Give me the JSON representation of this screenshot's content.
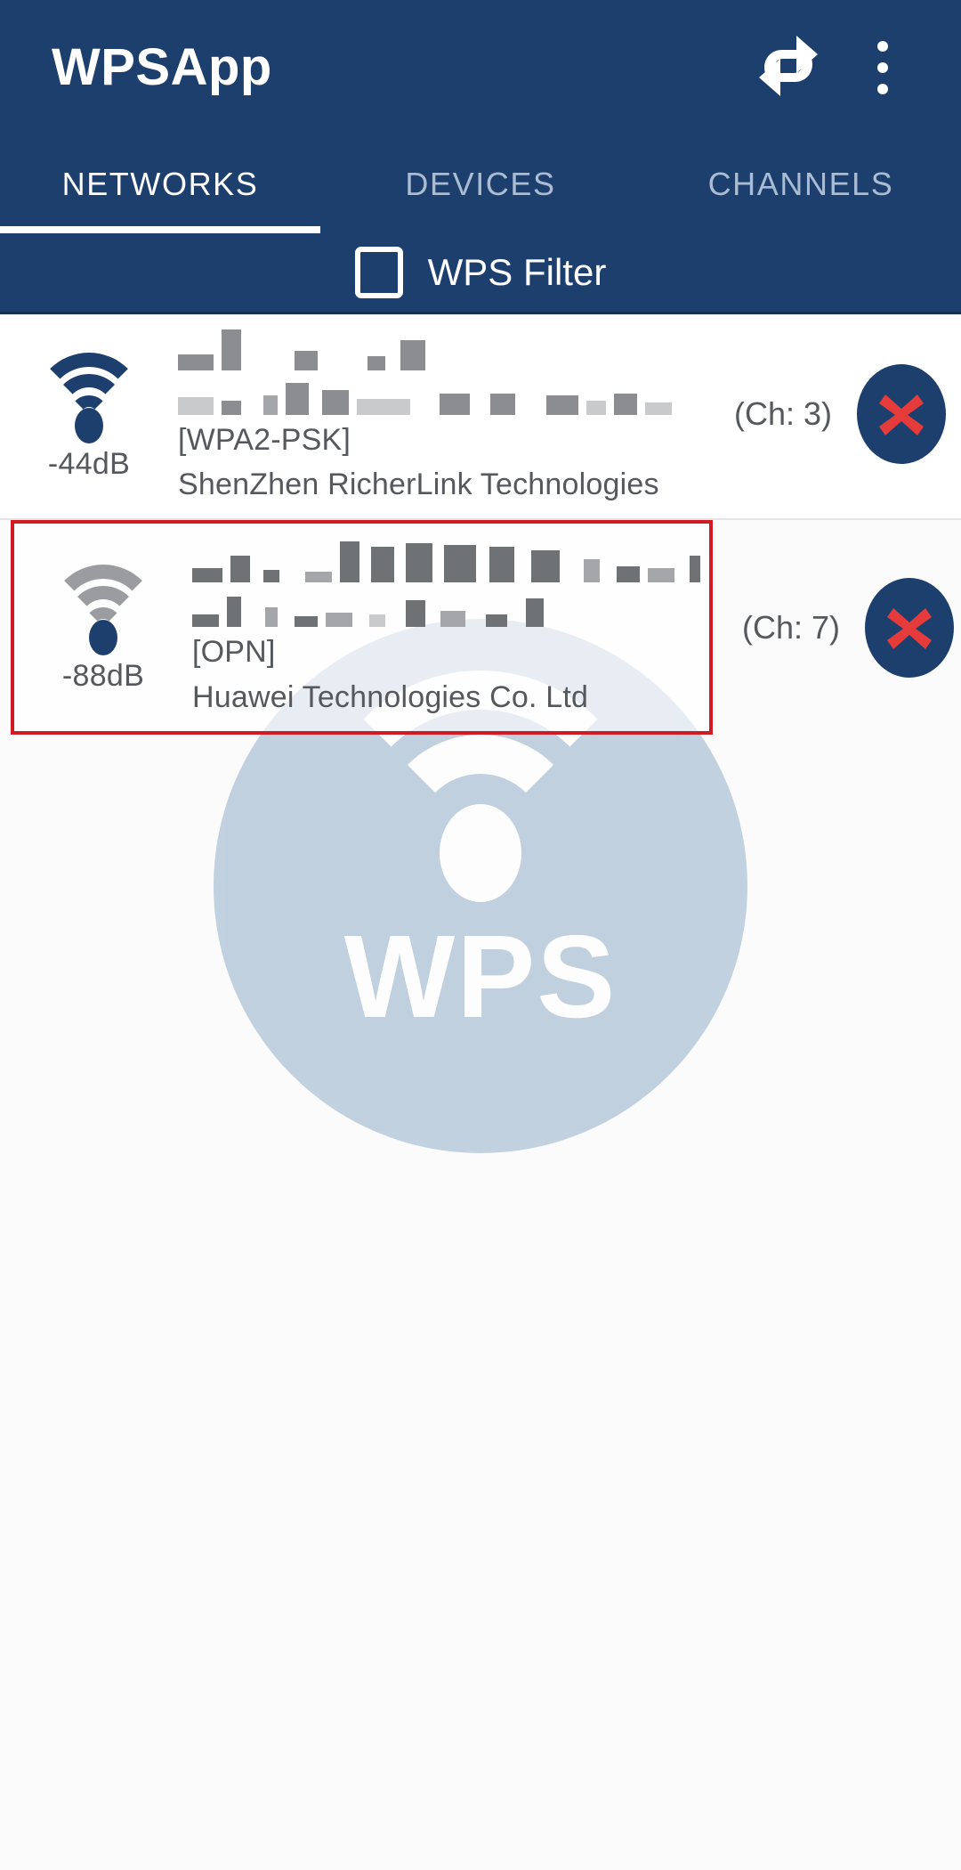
{
  "app": {
    "title": "WPSApp",
    "refresh_icon": "refresh-icon",
    "overflow_icon": "overflow-menu-icon",
    "accent_color": "#1d3f6e",
    "highlight_color": "#d01a24"
  },
  "tabs": [
    {
      "label": "NETWORKS",
      "active": true
    },
    {
      "label": "DEVICES",
      "active": false
    },
    {
      "label": "CHANNELS",
      "active": false
    }
  ],
  "filter": {
    "label": "WPS Filter",
    "checked": false
  },
  "watermark": {
    "text": "WPS",
    "icon": "wifi-icon",
    "color": "#9db6ce"
  },
  "networks": [
    {
      "ssid": "",
      "ssid_redacted": true,
      "signal": "-44dB",
      "signal_strength": 4,
      "signal_color": "#1d3f6e",
      "security": "[WPA2-PSK]",
      "vendor": "ShenZhen RicherLink Technologies",
      "channel": "(Ch: 3)",
      "status_icon": "cross-icon",
      "highlighted": false
    },
    {
      "ssid": "",
      "ssid_redacted": true,
      "signal": "-88dB",
      "signal_strength": 1,
      "signal_color": "#9a9c9f",
      "security": "[OPN]",
      "vendor": "Huawei Technologies Co. Ltd",
      "channel": "(Ch: 7)",
      "status_icon": "cross-icon",
      "highlighted": true
    }
  ]
}
